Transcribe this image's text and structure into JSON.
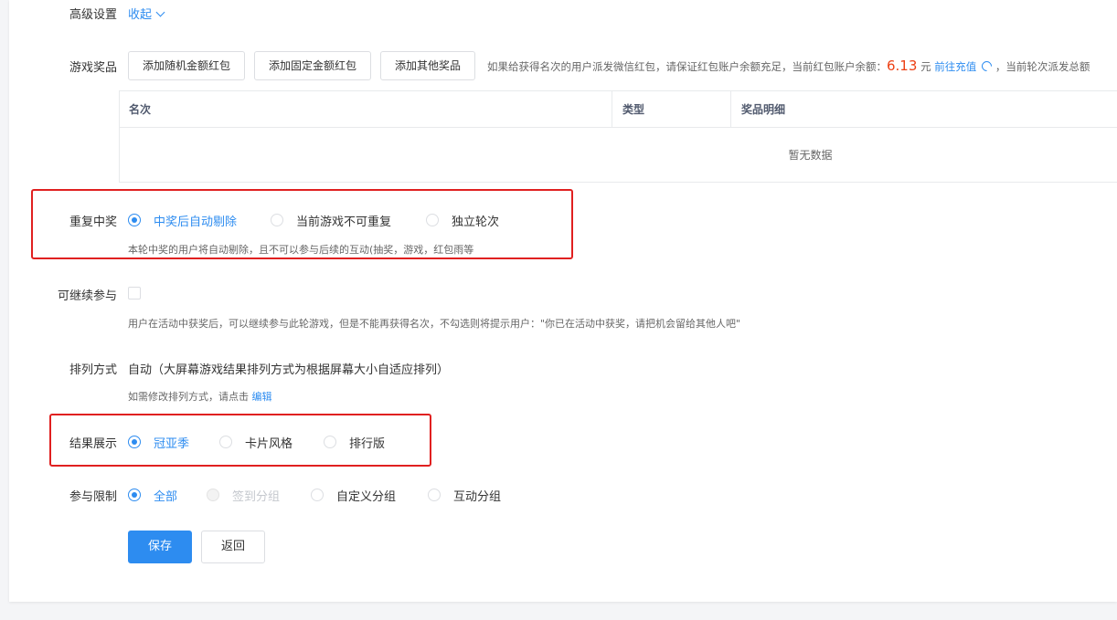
{
  "advanced": {
    "label": "高级设置",
    "toggle": "收起"
  },
  "prizes": {
    "label": "游戏奖品",
    "buttons": [
      "添加随机金额红包",
      "添加固定金额红包",
      "添加其他奖品"
    ],
    "note_before": "如果给获得名次的用户派发微信红包，请保证红包账户余额充足，当前红包账户余额：",
    "balance": "6.13",
    "unit": "元",
    "recharge": "前往充值",
    "note_after": "，当前轮次派发总额",
    "table": {
      "columns": [
        "名次",
        "类型",
        "奖品明细"
      ],
      "empty": "暂无数据"
    }
  },
  "repeat": {
    "label": "重复中奖",
    "options": [
      "中奖后自动剔除",
      "当前游戏不可重复",
      "独立轮次"
    ],
    "selected": 0,
    "note": "本轮中奖的用户将自动剔除，且不可以参与后续的互动(抽奖，游戏，红包雨等"
  },
  "continue": {
    "label": "可继续参与",
    "checked": false,
    "note": "用户在活动中获奖后，可以继续参与此轮游戏，但是不能再获得名次，不勾选则将提示用户：\"你已在活动中获奖，请把机会留给其他人吧\""
  },
  "arrange": {
    "label": "排列方式",
    "value": "自动（大屏幕游戏结果排列方式为根据屏幕大小自适应排列）",
    "note": "如需修改排列方式，请点击",
    "edit": "编辑"
  },
  "result": {
    "label": "结果展示",
    "options": [
      "冠亚季",
      "卡片风格",
      "排行版"
    ],
    "selected": 0
  },
  "limit": {
    "label": "参与限制",
    "options": [
      "全部",
      "签到分组",
      "自定义分组",
      "互动分组"
    ],
    "selected": 0,
    "disabled_option": "签到分组"
  },
  "actions": {
    "save": "保存",
    "back": "返回"
  },
  "colors": {
    "accent": "#2d8cf0",
    "highlight_box": "#e02020",
    "amount": "#ed4014"
  }
}
